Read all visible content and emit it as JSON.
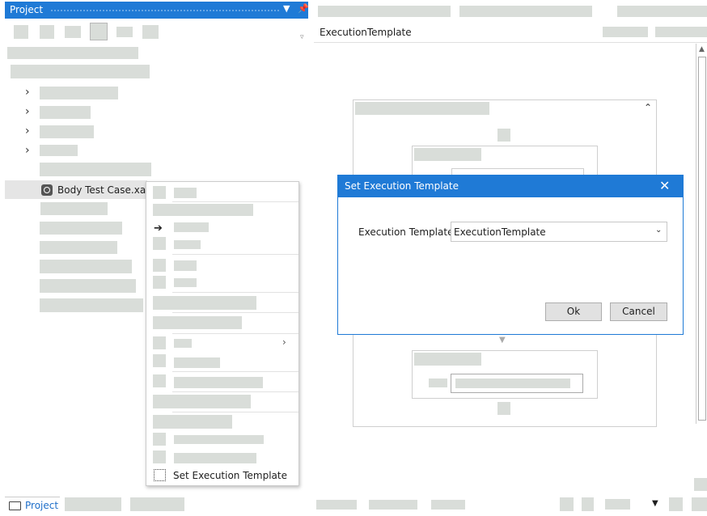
{
  "project_panel": {
    "title": "Project",
    "header_dropdown_icon": "chevron-down-icon",
    "header_pin_icon": "pin-icon",
    "selected_file": "Body Test Case.xaml"
  },
  "context_menu": {
    "last_item_label": "Set Execution Template"
  },
  "bottom_tabs": {
    "active_label": "Project"
  },
  "designer": {
    "title": "ExecutionTemplate"
  },
  "dialog": {
    "title": "Set Execution Template",
    "field_label": "Execution Template:",
    "field_value": "ExecutionTemplate",
    "ok_label": "Ok",
    "cancel_label": "Cancel"
  },
  "colors": {
    "accent": "#1f7ad6",
    "placeholder": "#d9ddd9"
  }
}
